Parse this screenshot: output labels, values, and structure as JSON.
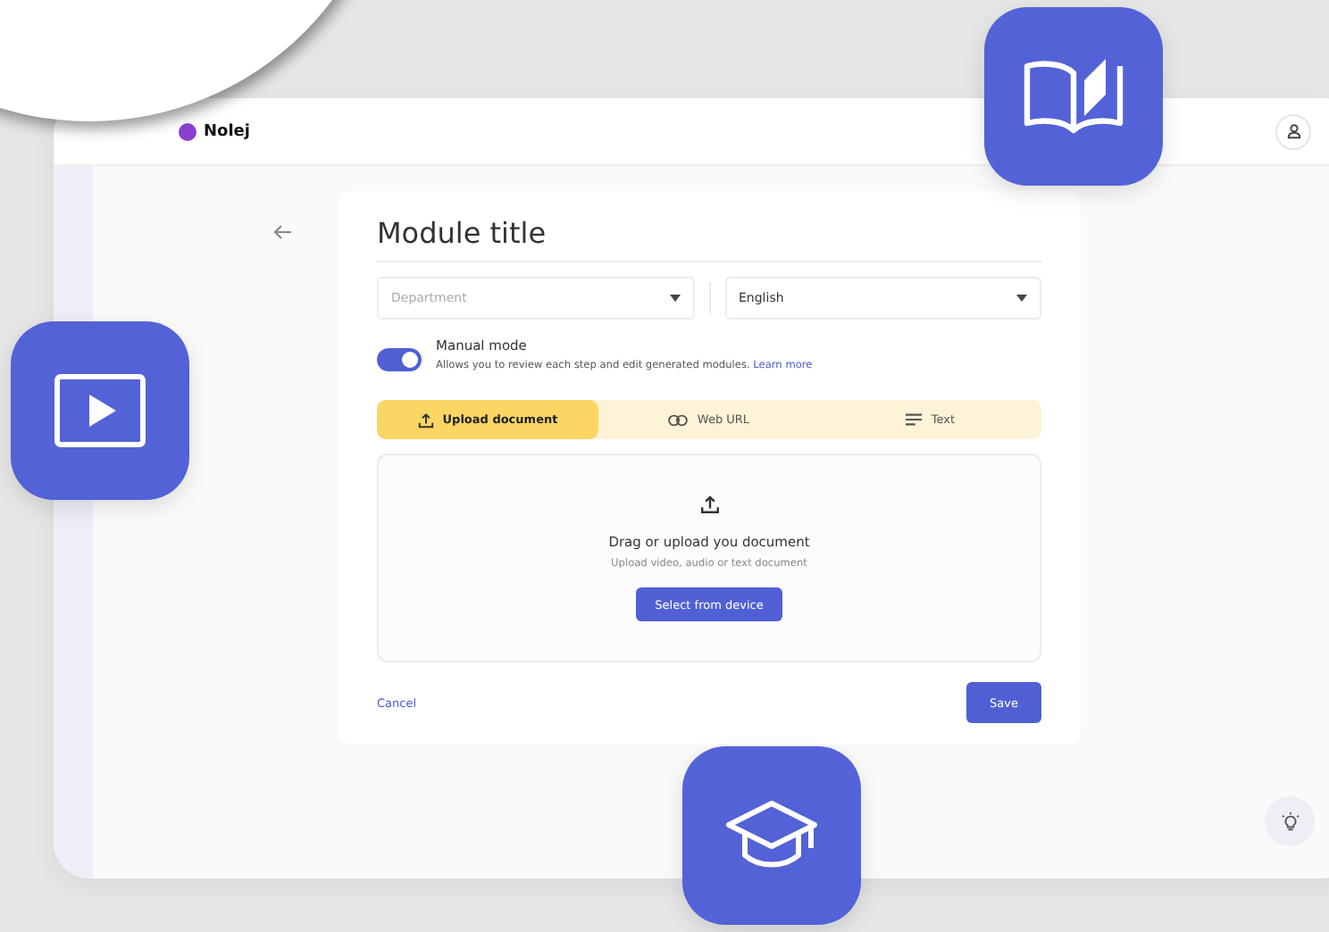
{
  "app": {
    "logo": "Nolej"
  },
  "form": {
    "title": "Module title",
    "department": {
      "placeholder": "Department"
    },
    "language": {
      "value": "English"
    },
    "manual_mode": {
      "label": "Manual mode",
      "on": true,
      "description": "Allows you to review each step and edit generated modules.",
      "link": "Learn more"
    },
    "tabs": [
      {
        "label": "Upload document",
        "selected": true
      },
      {
        "label": "Web URL",
        "selected": false
      },
      {
        "label": "Text",
        "selected": false
      }
    ],
    "dropzone": {
      "heading": "Drag or upload you document",
      "hint": "Upload video, audio or text document",
      "button": "Select from device"
    },
    "cancel": "Cancel",
    "save": "Save"
  }
}
